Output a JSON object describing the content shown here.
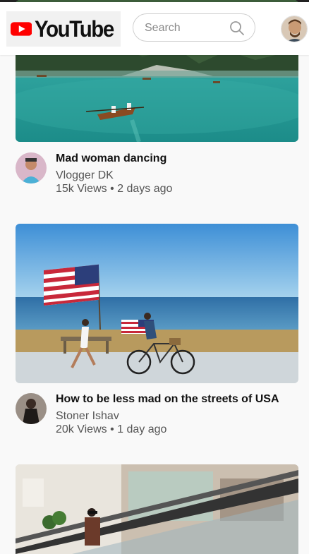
{
  "header": {
    "logo_text": "YouTube",
    "search": {
      "placeholder": "Search",
      "value": ""
    }
  },
  "videos": [
    {
      "title": "Mad woman dancing",
      "channel": "Vlogger DK",
      "views": "15k Views",
      "separator": "•",
      "age": "2 days ago"
    },
    {
      "title": "How to be less mad on the streets of USA",
      "channel": "Stoner Ishav",
      "views": "20k Views",
      "separator": "•",
      "age": "1 day ago"
    },
    {
      "title": "",
      "channel": "",
      "views": "",
      "separator": "",
      "age": ""
    }
  ],
  "colors": {
    "brand_red": "#ff0000",
    "background": "#f9f9f9"
  }
}
